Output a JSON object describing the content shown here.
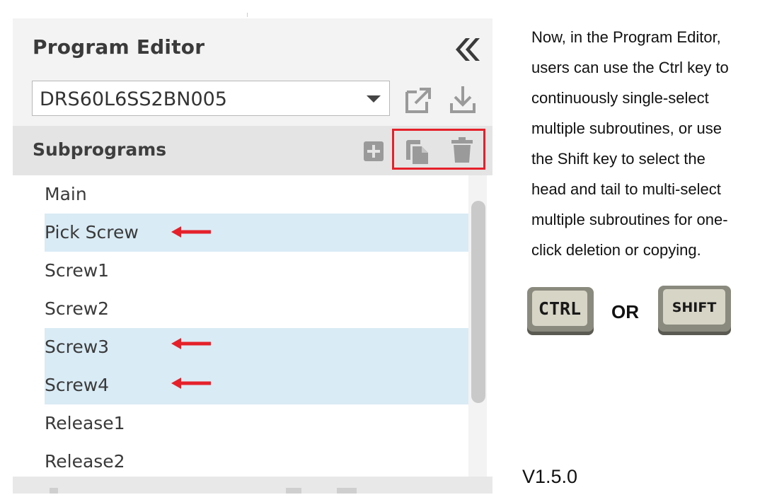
{
  "panel": {
    "title": "Program Editor",
    "program_select": {
      "value": "DRS60L6SS2BN005"
    },
    "subprograms": {
      "title": "Subprograms",
      "items": [
        {
          "label": "Main",
          "selected": false
        },
        {
          "label": "Pick Screw",
          "selected": true
        },
        {
          "label": "Screw1",
          "selected": false
        },
        {
          "label": "Screw2",
          "selected": false
        },
        {
          "label": "Screw3",
          "selected": true
        },
        {
          "label": "Screw4",
          "selected": true
        },
        {
          "label": "Release1",
          "selected": false
        },
        {
          "label": "Release2",
          "selected": false
        }
      ]
    }
  },
  "description": {
    "lines": [
      "Now, in the Program Editor,",
      "users can use the Ctrl key to",
      "continuously single-select",
      "multiple subroutines, or use",
      "the Shift key to select the",
      "head and tail to multi-select",
      "multiple subroutines for one-",
      "click deletion or copying."
    ]
  },
  "keys": {
    "ctrl_label": "CTRL",
    "or_label": "OR",
    "shift_label": "SHIFT"
  },
  "version": "V1.5.0",
  "colors": {
    "highlight": "#e5202a",
    "arrow": "#e5202a",
    "selected_row": "#d9ebf5",
    "icon_gray": "#9a9a9a"
  }
}
